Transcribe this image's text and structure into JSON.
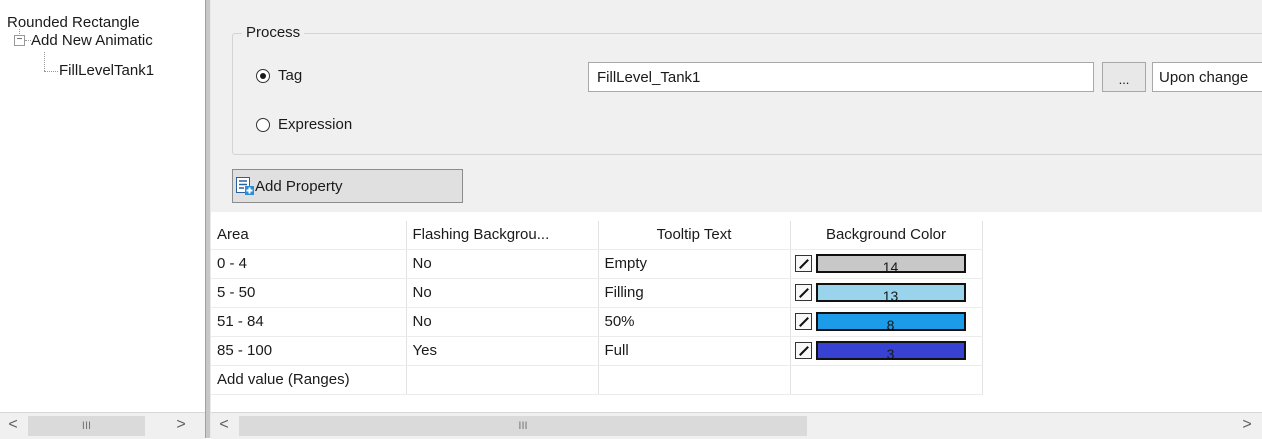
{
  "tree": {
    "root": "Rounded Rectangle",
    "child": "Add New Animatic",
    "leaf": "FillLevelTank1",
    "collapse_symbol": "−"
  },
  "process": {
    "title": "Process",
    "tag_label": "Tag",
    "expression_label": "Expression",
    "selected": "Tag",
    "tag_value": "FillLevel_Tank1",
    "browse_label": "...",
    "trigger": "Upon change"
  },
  "add_property_label": "Add Property",
  "grid": {
    "headers": [
      "Area",
      "Flashing Backgrou...",
      "Tooltip Text",
      "Background Color"
    ],
    "rows": [
      {
        "area": "0 - 4",
        "flashing": "No",
        "tooltip": "Empty",
        "color_index": "14",
        "color": "#c8c8c8"
      },
      {
        "area": "5 - 50",
        "flashing": "No",
        "tooltip": "Filling",
        "color_index": "13",
        "color": "#9ad4ec"
      },
      {
        "area": "51 - 84",
        "flashing": "No",
        "tooltip": "50%",
        "color_index": "8",
        "color": "#1c9be8"
      },
      {
        "area": "85 - 100",
        "flashing": "Yes",
        "tooltip": "Full",
        "color_index": "3",
        "color": "#3742d2"
      }
    ],
    "add_row_label": "Add value (Ranges)"
  },
  "scrollbars": {
    "left_arrow": "<",
    "right_arrow": ">",
    "thumb_grip": "III"
  }
}
